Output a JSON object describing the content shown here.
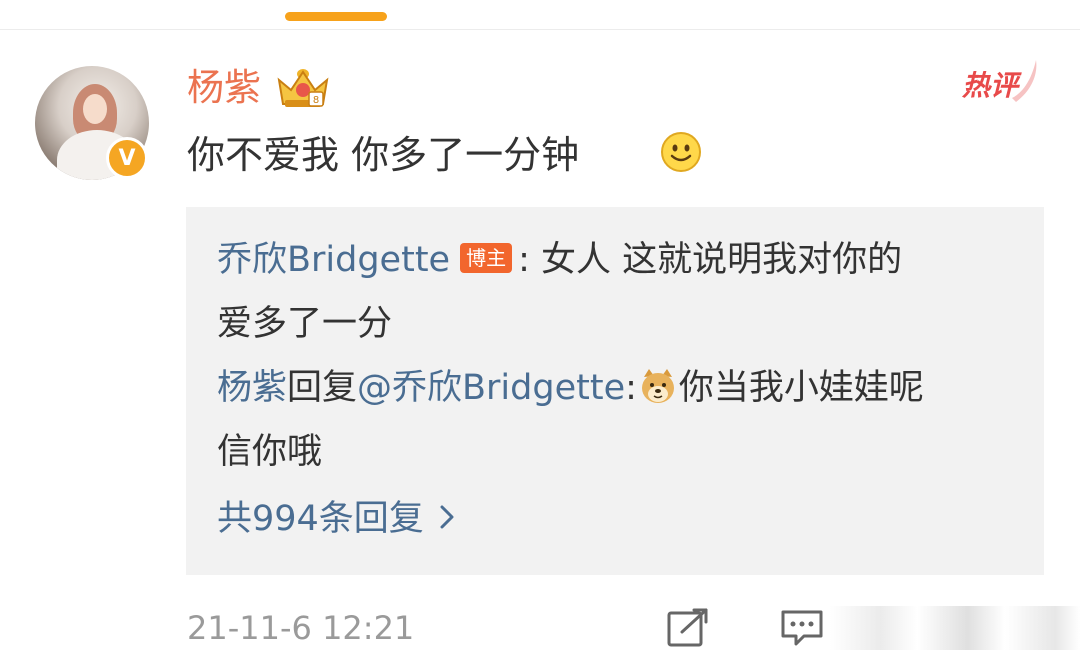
{
  "comment": {
    "username": "杨紫",
    "text": "你不爱我 你多了一分钟",
    "hot_label": "热评",
    "timestamp": "21-11-6 12:21",
    "avatar_badge": "V"
  },
  "reply_box": {
    "first_reply": {
      "author": "乔欣Bridgette",
      "author_tag": "博主",
      "text_line1": ": 女人 这就说明我对你的",
      "text_line2": "爱多了一分"
    },
    "second_reply": {
      "author": "杨紫",
      "reply_word": "回复",
      "mention": "@乔欣Bridgette",
      "colon": ":",
      "text_line1": "你当我小娃娃呢",
      "text_line2": "信你哦"
    },
    "more_replies": "共994条回复"
  },
  "colors": {
    "username": "#eb7350",
    "link": "#4a6d92",
    "hot": "#e84a4a",
    "tab_indicator": "#f7a21b",
    "blogger_tag": "#f2662d"
  },
  "icons": [
    "crown-icon",
    "verified-v-icon",
    "smile-icon",
    "doge-icon",
    "chevron-right-icon",
    "share-icon",
    "comment-icon"
  ]
}
